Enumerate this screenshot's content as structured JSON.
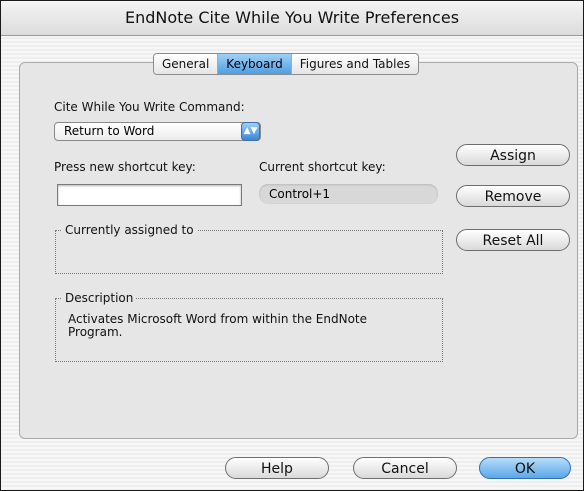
{
  "window": {
    "title": "EndNote Cite While You Write Preferences"
  },
  "tabs": [
    {
      "label": "General",
      "active": false
    },
    {
      "label": "Keyboard",
      "active": true
    },
    {
      "label": "Figures and Tables",
      "active": false
    }
  ],
  "keyboard": {
    "command_label": "Cite While You Write Command:",
    "command_value": "Return to Word",
    "new_key_label": "Press new shortcut key:",
    "new_key_value": "",
    "current_key_label": "Current shortcut key:",
    "current_key_value": "Control+1",
    "assigned_legend": "Currently assigned to",
    "assigned_value": "",
    "description_legend": "Description",
    "description_text": "Activates Microsoft Word from within the EndNote Program."
  },
  "side_buttons": {
    "assign": "Assign",
    "remove": "Remove",
    "reset_all": "Reset All"
  },
  "footer_buttons": {
    "help": "Help",
    "cancel": "Cancel",
    "ok": "OK"
  },
  "colors": {
    "accent": "#5aa7e8",
    "panel": "#e6e6e6"
  }
}
